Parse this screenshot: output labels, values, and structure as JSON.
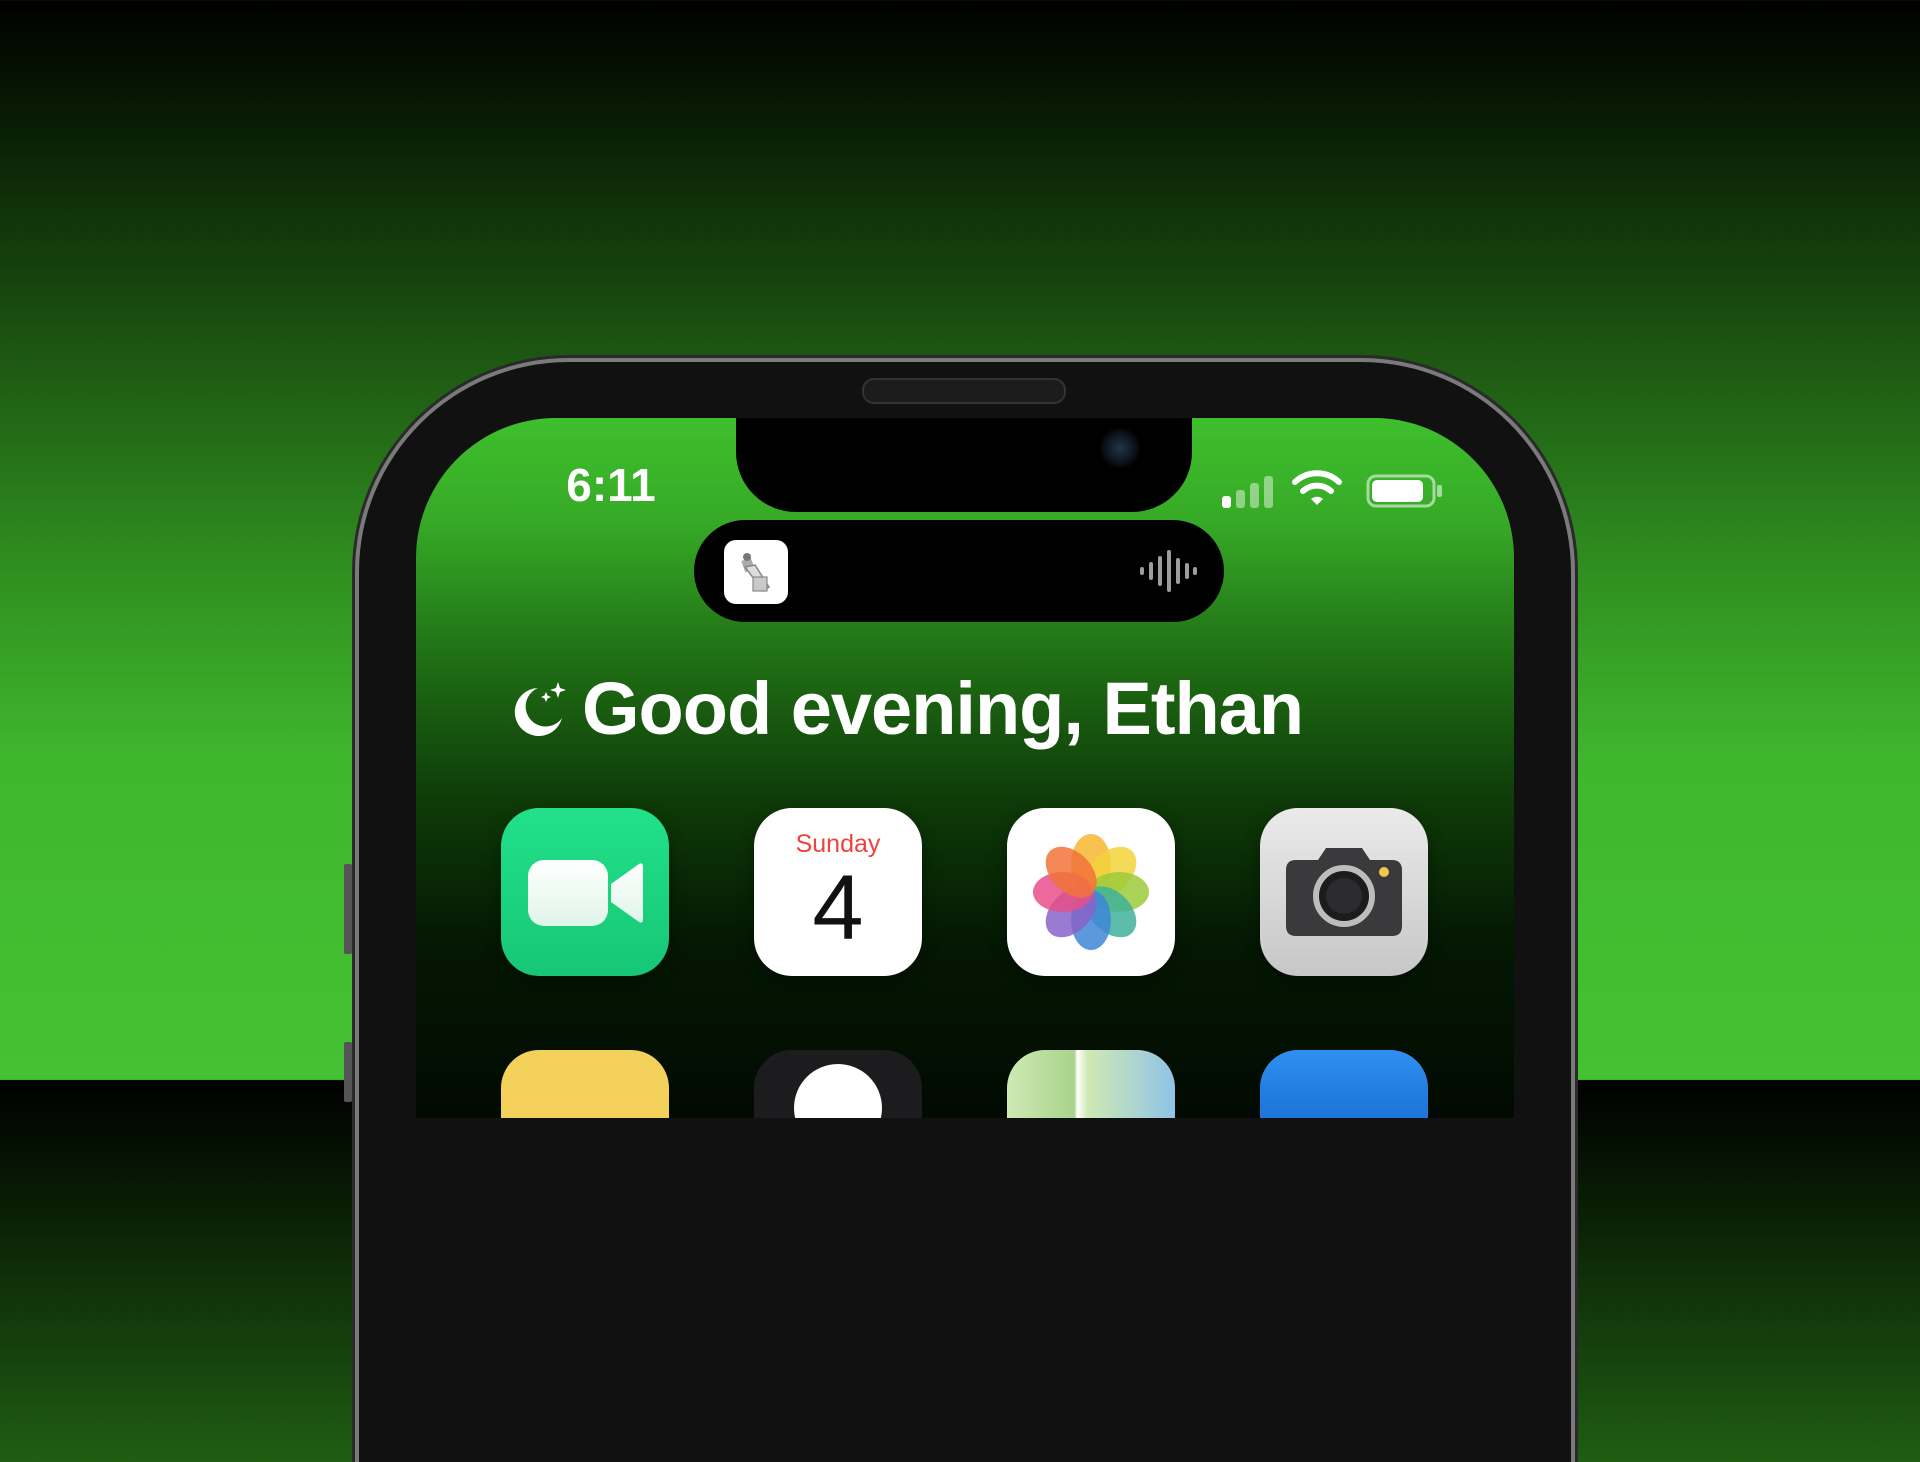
{
  "status_bar": {
    "time": "6:11",
    "signal_bars_active": 1,
    "signal_bars_total": 4,
    "wifi_icon": "wifi-icon",
    "battery_icon": "battery-icon"
  },
  "dynamic_island": {
    "app_icon": "now-playing-app-icon",
    "activity_icon": "waveform-icon"
  },
  "greeting": {
    "icon": "moon-stars-icon",
    "text": "Good evening, Ethan"
  },
  "apps": [
    {
      "name": "FaceTime",
      "icon": "facetime-icon",
      "color": "#1fd57f"
    },
    {
      "name": "Calendar",
      "icon": "calendar-icon",
      "day": "Sunday",
      "date": "4",
      "accent": "#f0423c"
    },
    {
      "name": "Photos",
      "icon": "photos-icon"
    },
    {
      "name": "Camera",
      "icon": "camera-icon"
    }
  ],
  "colors": {
    "background_top": "#000000",
    "background_bottom": "#45c233",
    "wallpaper_accent": "#3fbf2d"
  }
}
